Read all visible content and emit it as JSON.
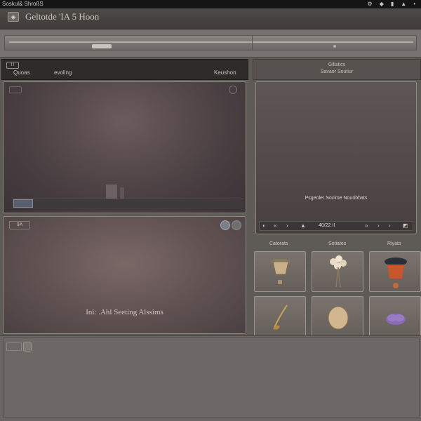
{
  "system_bar": {
    "left_text": "Soskul& ShroßS",
    "tray_icons": [
      "gear-icon",
      "shield-icon",
      "mic-icon",
      "bell-icon",
      "pin-icon"
    ]
  },
  "window": {
    "title": "Geltotde 'IA 5 Hoon"
  },
  "progress": {
    "value": 0.22
  },
  "tabs": {
    "icon_text": "l l",
    "q_label": "Quoas",
    "c_label": "evoling",
    "k_label": "Keushon"
  },
  "panel_mid": {
    "tag": "9A",
    "caption": "Ini: .Ahl Seeting Alssims"
  },
  "right_header": {
    "line1": "Giltstics",
    "line2": "Savaor Soutiur"
  },
  "preview": {
    "label": "Psgenler Socime Nouribhats",
    "counter": "40/22  II"
  },
  "thumb_labels": [
    "Catorats",
    "Sotiates",
    "Riyats"
  ],
  "thumbs": [
    {
      "name": "vase-item",
      "color": "#c9b08a"
    },
    {
      "name": "flower-bouquet-item",
      "color": "#e8dcc2"
    },
    {
      "name": "lantern-item",
      "color": "#c8562a"
    },
    {
      "name": "fiddle-item",
      "color": "#caa45a"
    },
    {
      "name": "egg-item",
      "color": "#d2b690"
    },
    {
      "name": "flower-item",
      "color": "#8a6ab4"
    }
  ],
  "colors": {
    "accent": "#5a7a9a"
  }
}
